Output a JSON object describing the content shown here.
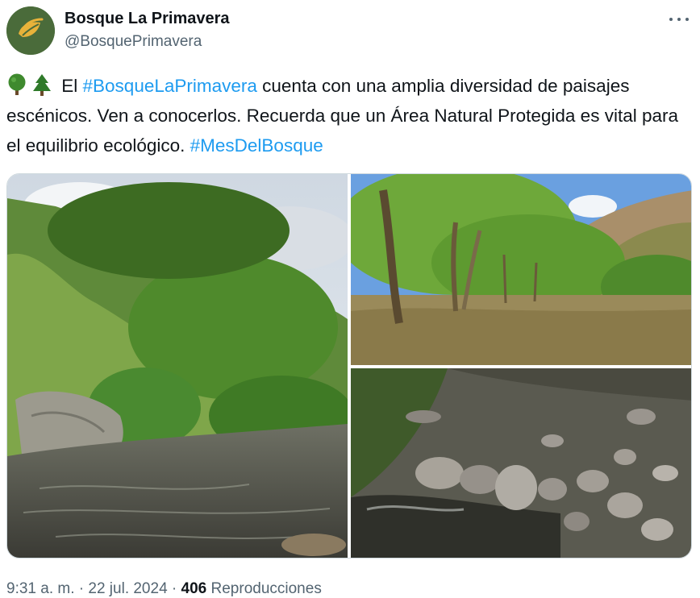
{
  "account": {
    "display_name": "Bosque La Primavera",
    "handle": "@BosquePrimavera",
    "avatar_icon": "leaf-logo-icon",
    "avatar_color": "#4a6b3a"
  },
  "more_icon": "more-dots-icon",
  "tweet": {
    "emojis": [
      "deciduous-tree-emoji",
      "evergreen-tree-emoji"
    ],
    "text_1": " El ",
    "hashtag_1": "#BosqueLaPrimavera",
    "text_2": " cuenta con una amplia diversidad de paisajes escénicos. Ven a conocerlos. Recuerda que un Área Natural Protegida es vital para el equilibrio ecológico.  ",
    "hashtag_2": "#MesDelBosque",
    "hashtag_color": "#1d9bf0"
  },
  "media": [
    {
      "description_icon": "photo-river-forest"
    },
    {
      "description_icon": "photo-forest-clearing"
    },
    {
      "description_icon": "photo-rocky-stream"
    }
  ],
  "footer": {
    "time": "9:31 a. m.",
    "separator": " · ",
    "date": "22 jul. 2024",
    "views_count": "406",
    "views_label": " Reproducciones"
  }
}
